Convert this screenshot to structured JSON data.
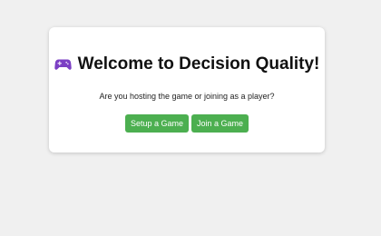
{
  "welcome": {
    "icon": "gamepad-icon",
    "title": "Welcome to Decision Quality!",
    "prompt": "Are you hosting the game or joining as a player?",
    "setup_label": "Setup a Game",
    "join_label": "Join a Game"
  },
  "colors": {
    "background": "#f0f0f0",
    "card": "#ffffff",
    "button": "#4caf50",
    "button_text": "#ffffff",
    "icon": "#7b3fc4"
  }
}
